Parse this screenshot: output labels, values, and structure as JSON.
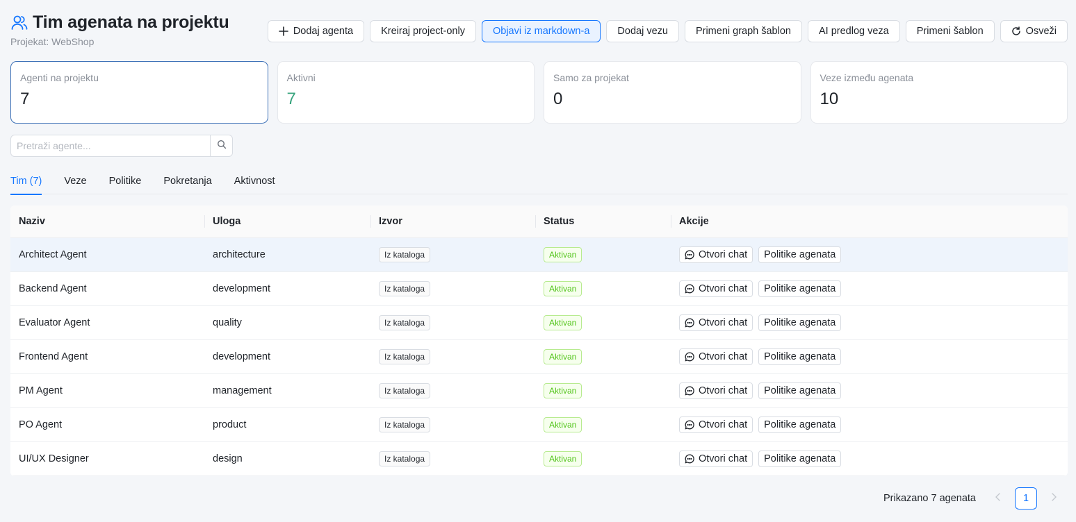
{
  "header": {
    "title": "Tim agenata na projektu",
    "subtitle": "Projekat: WebShop"
  },
  "toolbar": {
    "add_agent": "Dodaj agenta",
    "create_project_only": "Kreiraj project-only",
    "publish_markdown": "Objavi iz markdown-a",
    "add_link": "Dodaj vezu",
    "apply_graph_template": "Primeni graph šablon",
    "ai_link_suggestion": "AI predlog veza",
    "apply_template": "Primeni šablon",
    "refresh": "Osveži"
  },
  "stats": [
    {
      "label": "Agenti na projektu",
      "value": "7"
    },
    {
      "label": "Aktivni",
      "value": "7"
    },
    {
      "label": "Samo za projekat",
      "value": "0"
    },
    {
      "label": "Veze između agenata",
      "value": "10"
    }
  ],
  "search": {
    "placeholder": "Pretraži agente..."
  },
  "tabs": [
    "Tim (7)",
    "Veze",
    "Politike",
    "Pokretanja",
    "Aktivnost"
  ],
  "table": {
    "columns": [
      "Naziv",
      "Uloga",
      "Izvor",
      "Status",
      "Akcije"
    ],
    "rows": [
      {
        "name": "Architect Agent",
        "role": "architecture",
        "source": "Iz kataloga",
        "status": "Aktivan"
      },
      {
        "name": "Backend Agent",
        "role": "development",
        "source": "Iz kataloga",
        "status": "Aktivan"
      },
      {
        "name": "Evaluator Agent",
        "role": "quality",
        "source": "Iz kataloga",
        "status": "Aktivan"
      },
      {
        "name": "Frontend Agent",
        "role": "development",
        "source": "Iz kataloga",
        "status": "Aktivan"
      },
      {
        "name": "PM Agent",
        "role": "management",
        "source": "Iz kataloga",
        "status": "Aktivan"
      },
      {
        "name": "PO Agent",
        "role": "product",
        "source": "Iz kataloga",
        "status": "Aktivan"
      },
      {
        "name": "UI/UX Designer",
        "role": "design",
        "source": "Iz kataloga",
        "status": "Aktivan"
      }
    ],
    "open_chat_label": "Otvori chat",
    "policies_label": "Politike agenata"
  },
  "pagination": {
    "info": "Prikazano 7 agenata",
    "current_page": "1"
  },
  "colors": {
    "accent": "#1677ff",
    "active_value": "#3aa57f",
    "status_green": "#52c41a"
  },
  "icons": {
    "title": "users-icon",
    "add": "plus-icon",
    "refresh": "refresh-icon",
    "search": "search-icon",
    "chat": "chat-bubble-icon",
    "prev": "chevron-left-icon",
    "next": "chevron-right-icon"
  }
}
